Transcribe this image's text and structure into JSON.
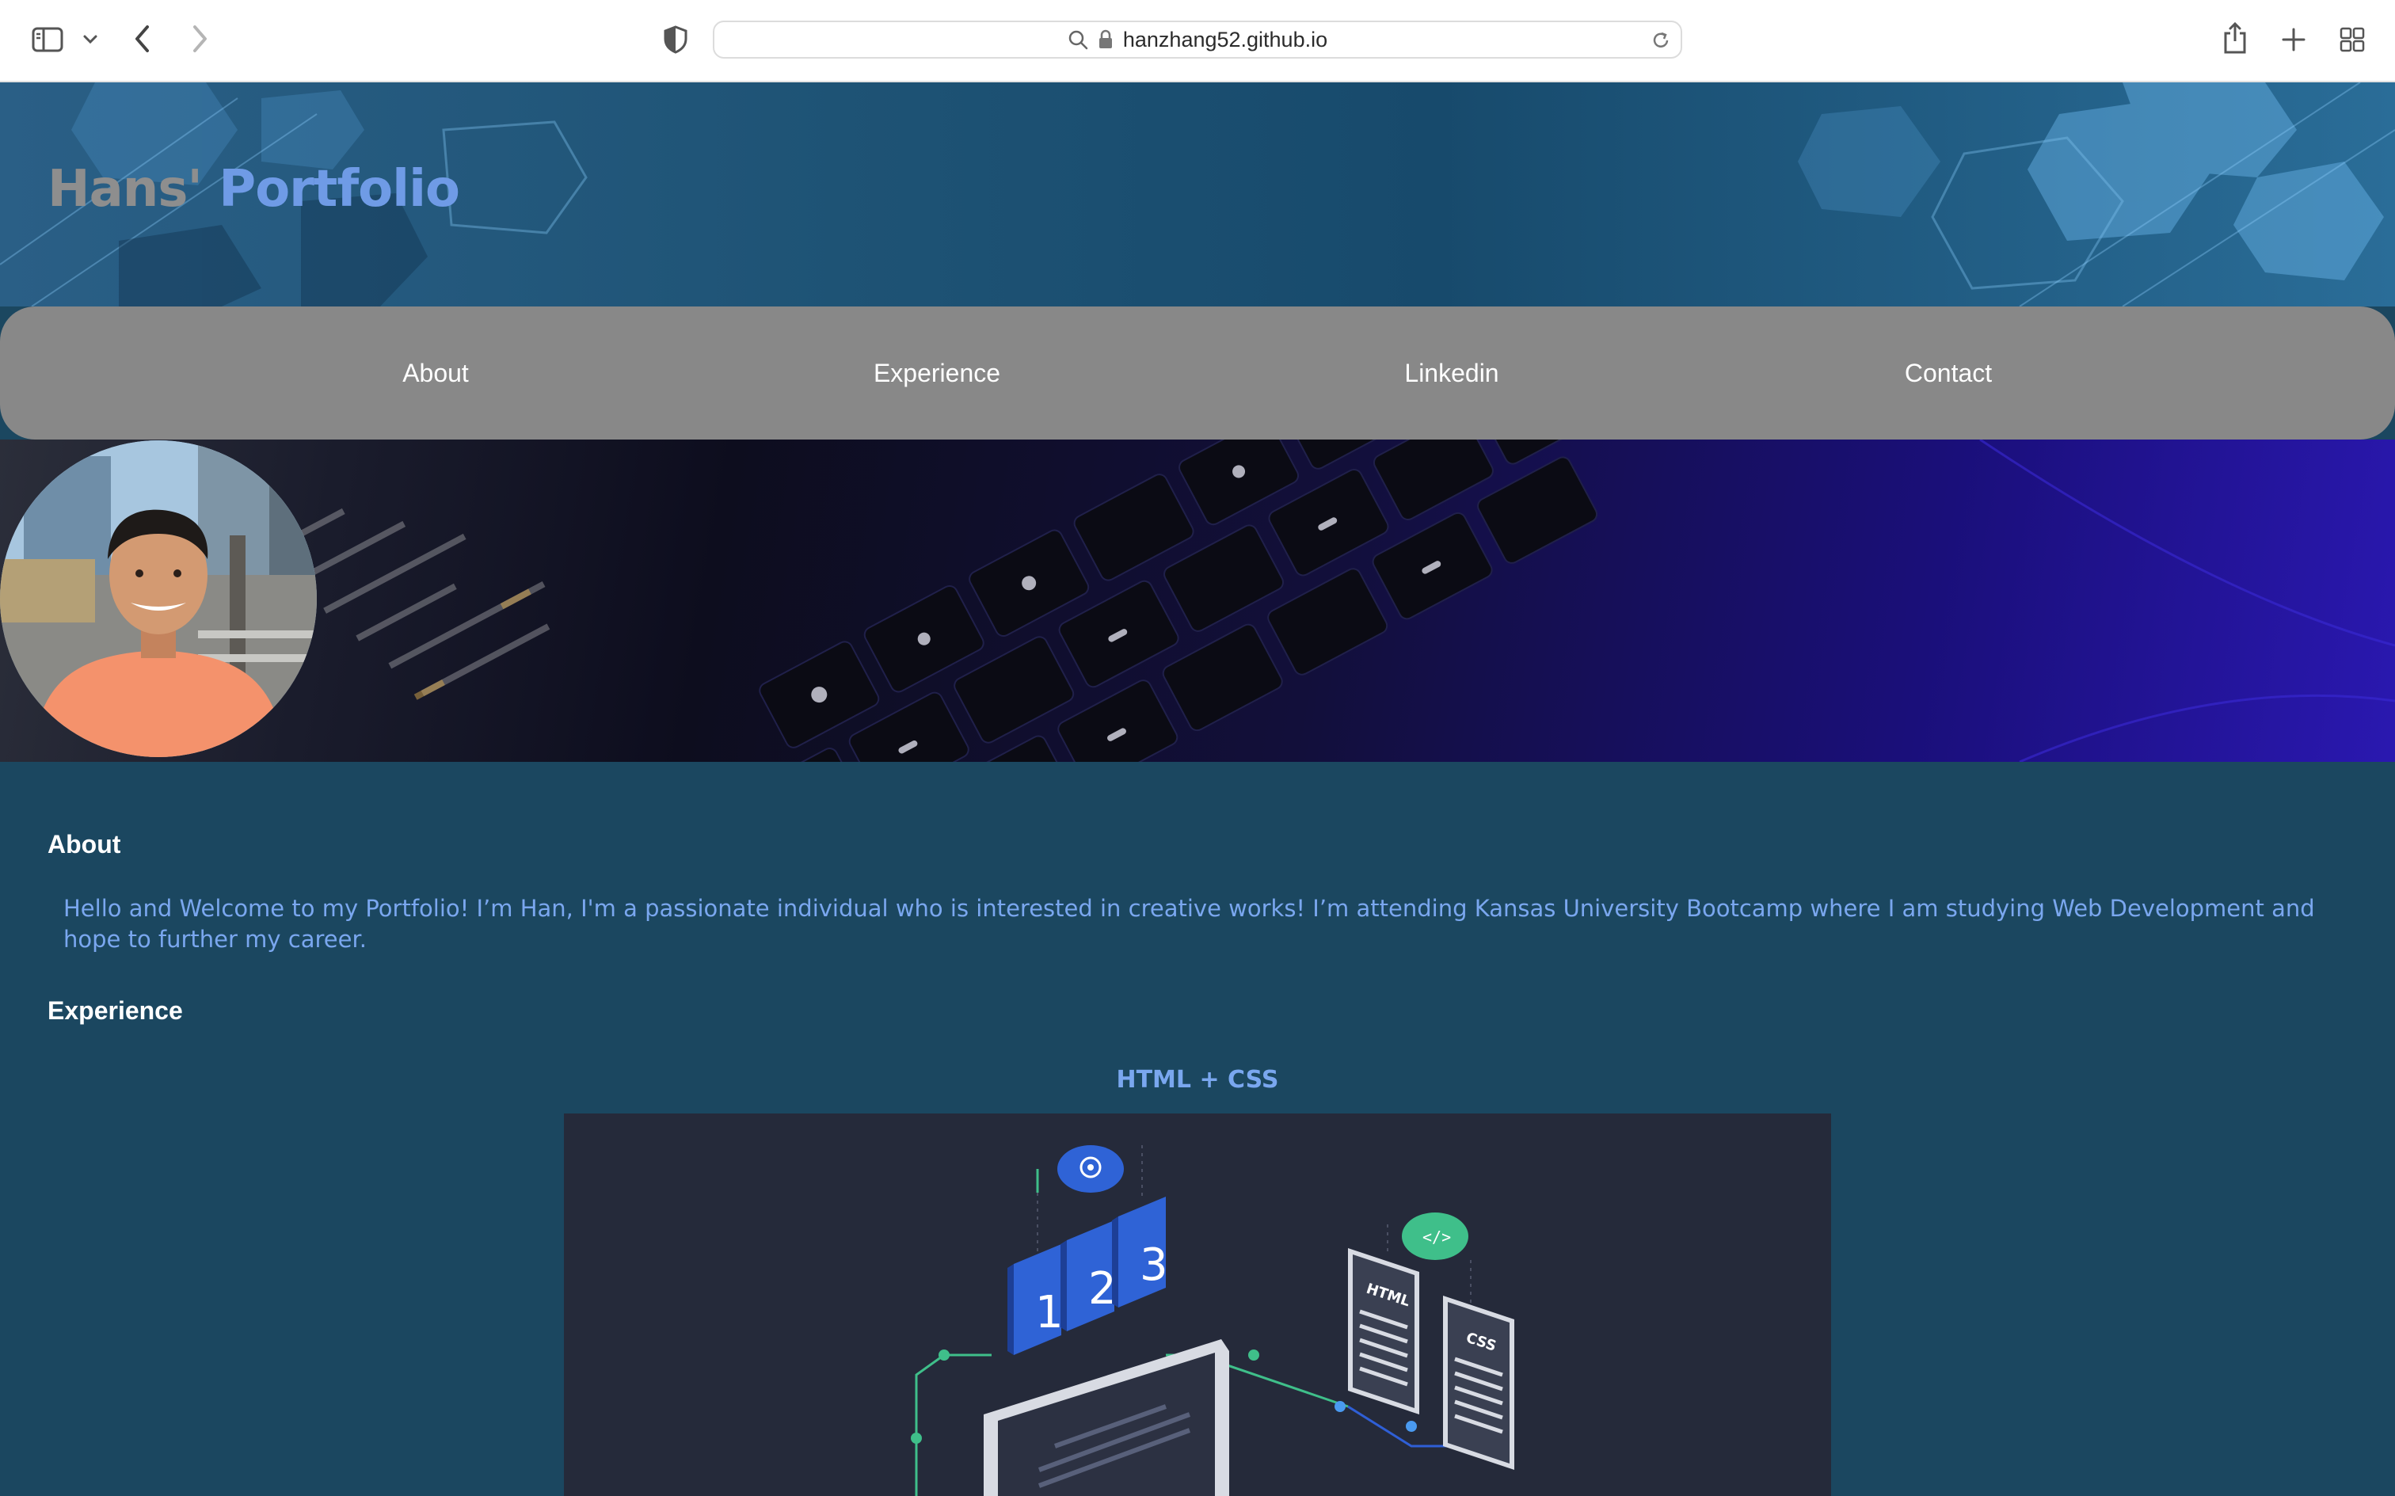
{
  "browser": {
    "url": "hanzhang52.github.io",
    "icons": [
      "sidebar-icon",
      "chevron-down-icon",
      "back-icon",
      "forward-icon",
      "privacy-shield-icon",
      "search-icon",
      "lock-icon",
      "reload-icon",
      "share-icon",
      "new-tab-icon",
      "tab-overview-icon"
    ]
  },
  "header": {
    "title_part1": "Hans'",
    "title_part2": "Portfolio"
  },
  "nav": {
    "items": [
      {
        "label": "About"
      },
      {
        "label": "Experience"
      },
      {
        "label": "Linkedin"
      },
      {
        "label": "Contact"
      }
    ]
  },
  "about": {
    "heading": "About",
    "text": "Hello and Welcome to my Portfolio! I’m Han, I'm a passionate individual who is interested in creative works! I’m attending Kansas University Bootcamp where I am studying Web Development and hope to further my career."
  },
  "experience": {
    "heading": "Experience",
    "cards": [
      {
        "title": "HTML + CSS",
        "image_labels": {
          "step1": "1",
          "step2": "2",
          "step3": "3",
          "doc1": "HTML",
          "doc2": "CSS",
          "code_tag": "</>"
        }
      }
    ]
  },
  "colors": {
    "page_bg": "#1b4760",
    "nav_bg": "#888888",
    "title_gray": "#8e8e8e",
    "title_blue": "#6f9be6",
    "link_blue": "#7aa7ef",
    "card_bg": "#252a3a"
  }
}
